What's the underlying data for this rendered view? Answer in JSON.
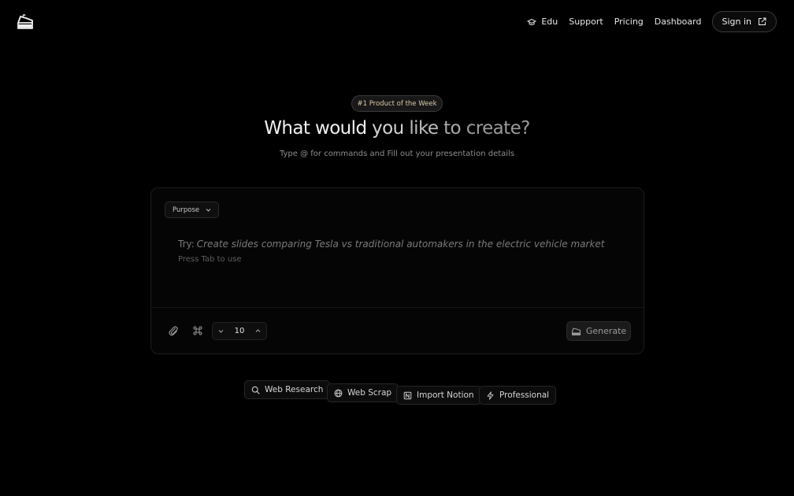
{
  "header": {
    "nav": [
      {
        "label": "Edu",
        "icon": "graduation-cap-icon"
      },
      {
        "label": "Support"
      },
      {
        "label": "Pricing"
      },
      {
        "label": "Dashboard"
      }
    ],
    "signin_label": "Sign in"
  },
  "hero": {
    "badge": "#1 Product of the Week",
    "title_words": [
      "What",
      "would",
      "you",
      "like",
      "to",
      "create?"
    ],
    "subtitle": "Type @ for commands and Fill out your presentation details"
  },
  "composer": {
    "purpose_label": "Purpose",
    "prompt_prefix": "Try:",
    "prompt_example": "Create slides comparing Tesla vs traditional automakers in the electric vehicle market",
    "hint": "Press Tab to use",
    "slide_count": "10",
    "generate_label": "Generate"
  },
  "chips": [
    {
      "label": "Web Research",
      "icon": "search-icon"
    },
    {
      "label": "Web Scrap",
      "icon": "globe-icon"
    },
    {
      "label": "Import Notion",
      "icon": "notion-icon"
    },
    {
      "label": "Professional",
      "icon": "bolt-icon"
    }
  ],
  "colors": {
    "background": "#000000",
    "badge_text": "#d9c8a6"
  }
}
